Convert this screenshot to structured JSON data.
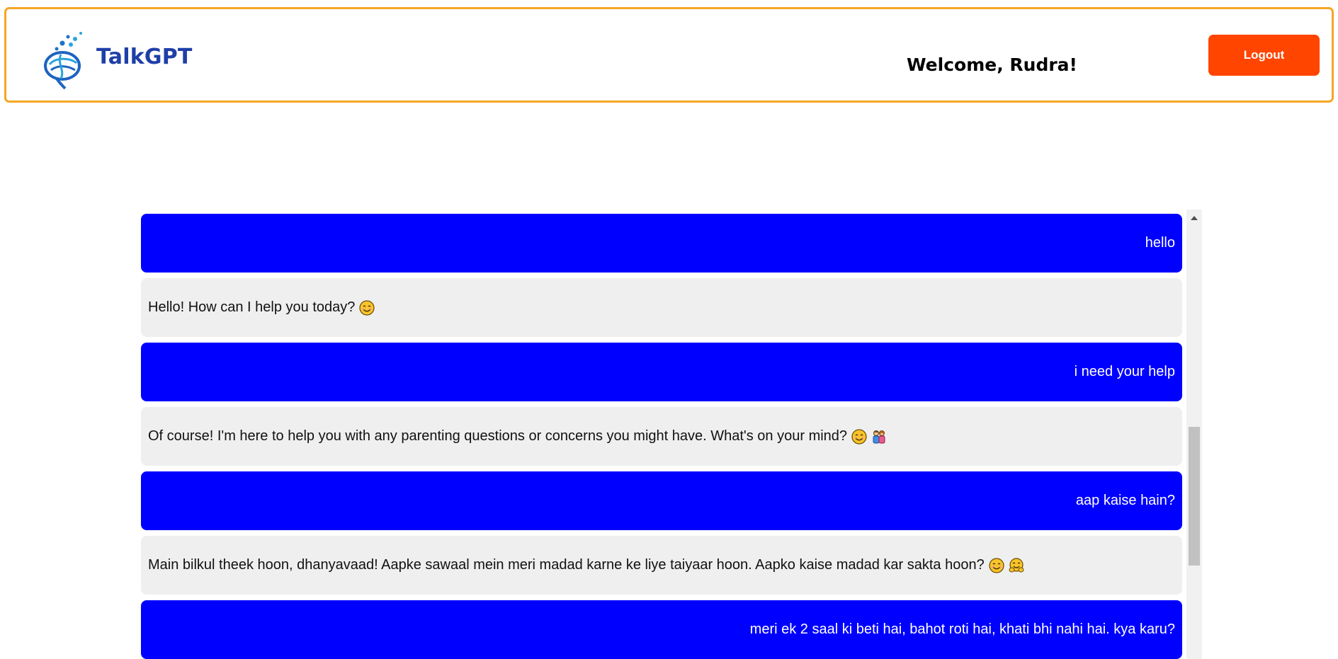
{
  "header": {
    "brand": "TalkGPT",
    "welcome": "Welcome, Rudra!",
    "logout_label": "Logout",
    "logo_icon": "brain-logo-icon"
  },
  "colors": {
    "header_border": "#f5a623",
    "brand": "#1f3fa8",
    "logout_bg": "#ff4500",
    "user_bubble": "#0000ff",
    "bot_bubble": "#efefef"
  },
  "messages": [
    {
      "role": "user",
      "text": "hello"
    },
    {
      "role": "bot",
      "text": "Hello! How can I help you today?",
      "emojis": [
        "smiling-face-icon"
      ]
    },
    {
      "role": "user",
      "text": "i need your help"
    },
    {
      "role": "bot",
      "text": "Of course! I'm here to help you with any parenting questions or concerns you might have. What's on your mind?",
      "emojis": [
        "smiling-face-icon",
        "family-icon"
      ]
    },
    {
      "role": "user",
      "text": "aap kaise hain?"
    },
    {
      "role": "bot",
      "text": "Main bilkul theek hoon, dhanyavaad! Aapke sawaal mein meri madad karne ke liye taiyaar hoon. Aapko kaise madad kar sakta hoon?",
      "emojis": [
        "smiling-face-icon",
        "hugging-face-icon"
      ]
    },
    {
      "role": "user",
      "text": "meri ek 2 saal ki beti hai, bahot roti hai, khati bhi nahi hai. kya karu?"
    }
  ]
}
